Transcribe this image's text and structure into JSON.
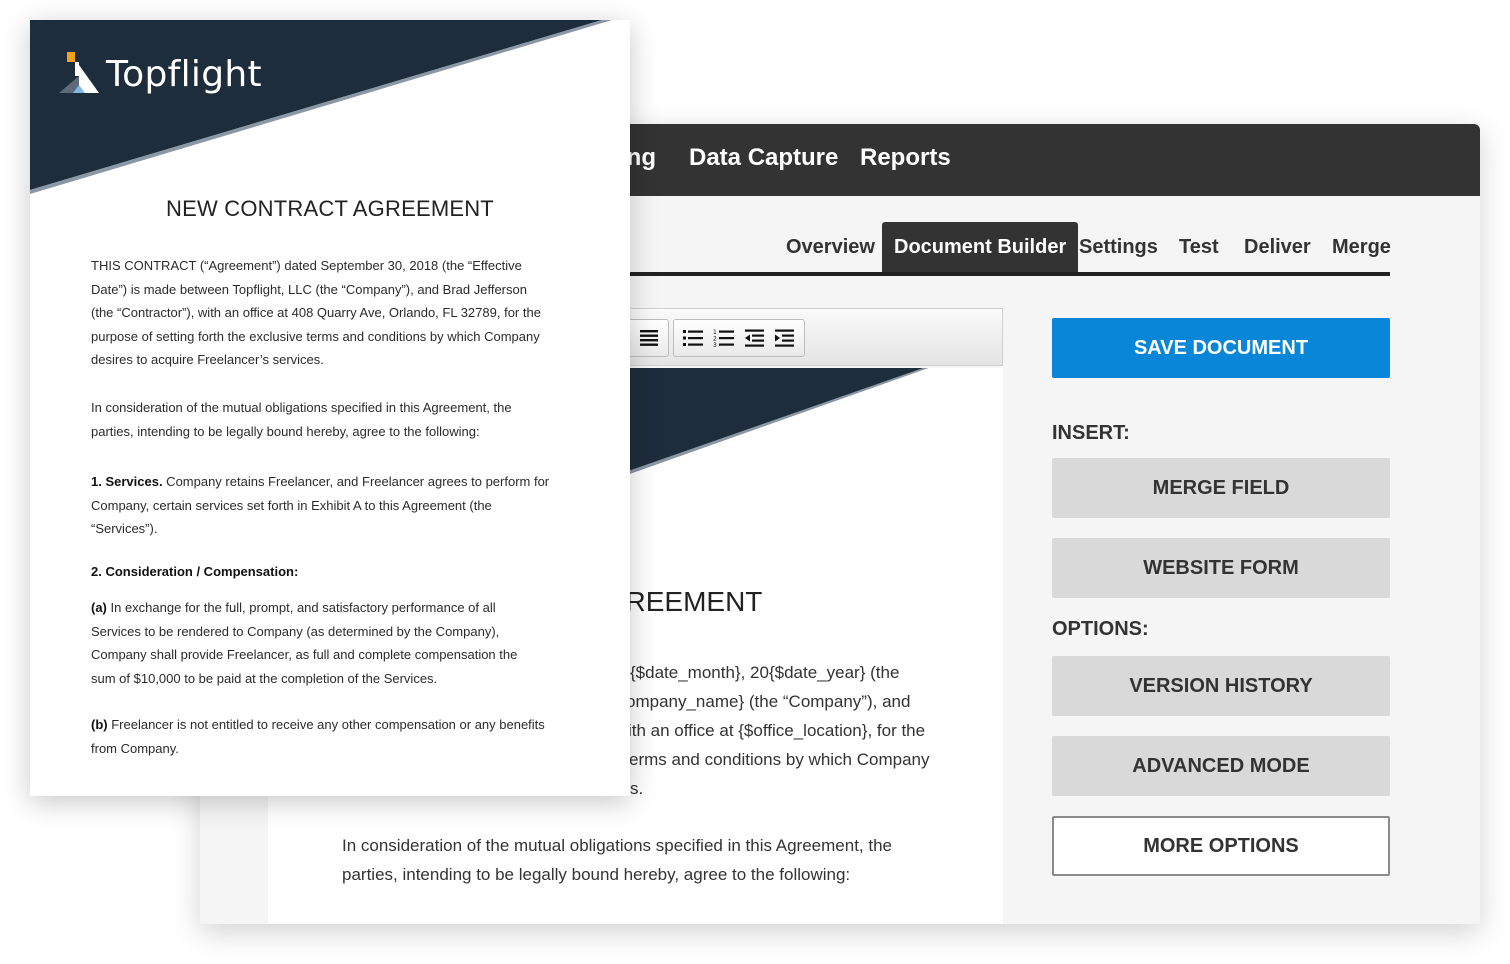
{
  "app": {
    "top_nav": {
      "partial_item": "ing",
      "items": [
        "Data Capture",
        "Reports"
      ]
    },
    "tabs": [
      {
        "label": "Overview",
        "active": false
      },
      {
        "label": "Document Builder",
        "active": true
      },
      {
        "label": "Settings",
        "active": false
      },
      {
        "label": "Test",
        "active": false
      },
      {
        "label": "Deliver",
        "active": false
      },
      {
        "label": "Merge",
        "active": false
      }
    ],
    "editor": {
      "toolbar_icons": [
        "justify-icon",
        "bulleted-list-icon",
        "numbered-list-icon",
        "outdent-icon",
        "indent-icon"
      ],
      "title_fragment": "CT AGREEMENT",
      "para1_lines": [
        "{$date_month}, 20{$date_year} (the",
        "ompany_name} (the “Company”), and",
        "ith an office at {$office_location}, for the",
        "erms and conditions by which Company",
        "s."
      ],
      "para2_lines": [
        "In consideration of the mutual obligations specified in this Agreement, the",
        "parties, intending to be legally bound hereby, agree to the following:"
      ]
    },
    "panel": {
      "save_label": "SAVE DOCUMENT",
      "insert_label": "INSERT:",
      "merge_field_label": "MERGE FIELD",
      "website_form_label": "WEBSITE FORM",
      "options_label": "OPTIONS:",
      "version_history_label": "VERSION HISTORY",
      "advanced_mode_label": "ADVANCED MODE",
      "more_options_label": "MORE OPTIONS"
    }
  },
  "document": {
    "brand_name": "Topflight",
    "title": "NEW CONTRACT AGREEMENT",
    "intro_lines": [
      "THIS CONTRACT (“Agreement”) dated September 30, 2018 (the “Effective",
      "Date”) is made between Topflight, LLC (the “Company”), and Brad Jefferson",
      "(the “Contractor”), with an office at 408 Quarry Ave, Orlando, FL 32789, for the",
      "purpose of setting forth the exclusive terms and conditions by which Company",
      "desires to acquire Freelancer’s services."
    ],
    "consideration_lines": [
      "In consideration of the mutual obligations specified in this Agreement, the",
      "parties, intending to be legally bound hereby, agree to the following:"
    ],
    "services": {
      "heading": "1. Services.",
      "lines": [
        " Company retains Freelancer, and Freelancer agrees to perform for",
        "Company, certain services set forth in Exhibit A to this Agreement (the",
        "“Services”)."
      ]
    },
    "compensation_heading": "2. Consideration / Compensation:",
    "clause_a": {
      "label": "(a)",
      "lines": [
        " In exchange for the full, prompt, and satisfactory performance of all",
        "Services to be rendered to Company (as determined by the Company),",
        "Company shall provide Freelancer, as full and complete compensation the",
        "sum of $10,000 to be paid at the completion of the Services."
      ]
    },
    "clause_b": {
      "label": "(b)",
      "lines": [
        " Freelancer is not entitled to receive any other compensation or any benefits",
        "from Company."
      ]
    }
  },
  "colors": {
    "nav_bg": "#333333",
    "brand_navy": "#1e2d3b",
    "accent_blue": "#0a86d8",
    "button_gray": "#d9d9d9",
    "logo_orange": "#f3a21b",
    "logo_blue": "#7fb8e0"
  }
}
